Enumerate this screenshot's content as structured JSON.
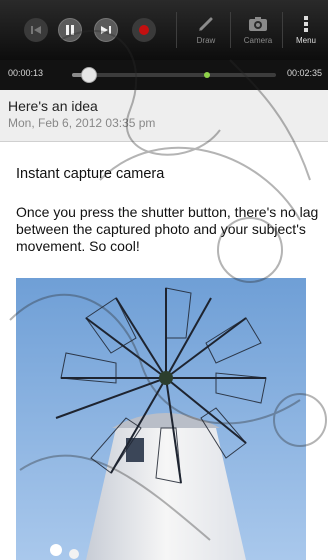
{
  "toolbar": {
    "draw_label": "Draw",
    "camera_label": "Camera",
    "menu_label": "Menu"
  },
  "playback": {
    "current_time": "00:00:13",
    "total_time": "00:02:35",
    "progress": 0.084
  },
  "note": {
    "title": "Here's an idea",
    "date": "Mon, Feb 6, 2012 03:35 pm",
    "heading": "Instant capture camera",
    "body": "Once you press the shutter button, there's no lag between the captured photo and your subject's movement. So cool!"
  },
  "colors": {
    "toolbar_bg": "#141414",
    "record": "#c41010",
    "marker": "#8fd24a",
    "sky": "#8cb4e0"
  }
}
